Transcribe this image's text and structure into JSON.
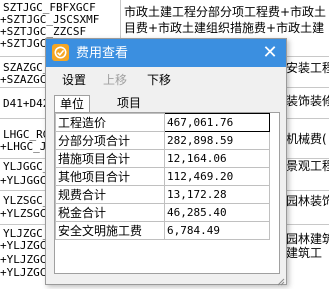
{
  "background": {
    "codes": [
      "SZTJGC_FBFXGCF",
      "+SZTJGC_JSCSXMF",
      "+SZTJGC_ZZCSF",
      "+SZTJGC_",
      "SZAZGC_",
      "+SZAZGC",
      "D41+D42",
      "LHGC_RG",
      "+LHGC_J",
      "YLJGGC_",
      "+YLJGGC",
      "YLZSGC_",
      "+YLZSGC",
      "YLJZGC_",
      "+YLJZGC",
      "+YLJZGC",
      "+YLJZGC"
    ],
    "descriptions": [
      "市政土建工程分部分项工程费+市政土",
      "目费+市政土建组织措施费+市政土建",
      "安装工程",
      "装饰装修",
      "机械费(",
      "景观工程",
      "园林装饰",
      "园林建筑",
      "建筑工"
    ]
  },
  "dialog": {
    "title": "费用查看",
    "toolbar": {
      "settings": "设置",
      "move_up": "上移",
      "move_down": "下移"
    },
    "tabs": [
      "单位",
      "项目"
    ],
    "rows": [
      {
        "name": "工程造价",
        "value": "467,061.76"
      },
      {
        "name": "分部分项合计",
        "value": "282,898.59"
      },
      {
        "name": "措施项目合计",
        "value": "12,164.06"
      },
      {
        "name": "其他项目合计",
        "value": "112,469.20"
      },
      {
        "name": "规费合计",
        "value": "13,172.28"
      },
      {
        "name": "税金合计",
        "value": "46,285.40"
      },
      {
        "name": "安全文明施工费",
        "value": "6,784.49"
      }
    ]
  }
}
